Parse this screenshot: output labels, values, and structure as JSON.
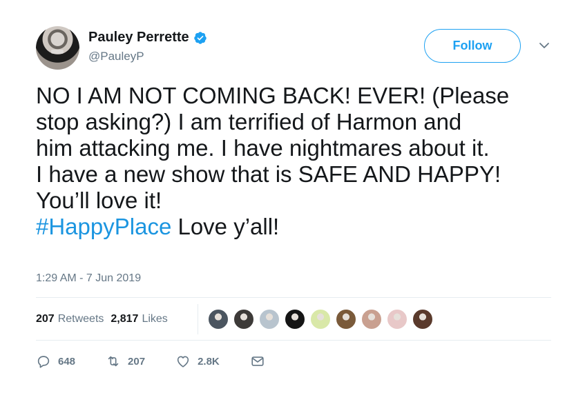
{
  "author": {
    "display_name": "Pauley Perrette",
    "handle": "@PauleyP",
    "verified": true
  },
  "follow_label": "Follow",
  "tweet": {
    "lines": [
      "NO I AM NOT COMING BACK! EVER!  (Please",
      "stop asking?) I am terrified of Harmon and",
      "him attacking me. I have nightmares about it.",
      "I have a new show that is SAFE AND HAPPY!",
      "You’ll love it!"
    ],
    "hashtag": "#HappyPlace",
    "hashtag_suffix": " Love y’all!"
  },
  "timestamp": "1:29 AM - 7 Jun 2019",
  "stats": {
    "retweets_count": "207",
    "retweets_label": "Retweets",
    "likes_count": "2,817",
    "likes_label": "Likes"
  },
  "likers": [
    {
      "color": "#4b5560"
    },
    {
      "color": "#3d3a38"
    },
    {
      "color": "#b8c4ce"
    },
    {
      "color": "#151515"
    },
    {
      "color": "#d9e8a8"
    },
    {
      "color": "#7a5a3a"
    },
    {
      "color": "#c9a090"
    },
    {
      "color": "#e8c8c8"
    },
    {
      "color": "#5a3a2c"
    }
  ],
  "actions": {
    "reply_count": "648",
    "retweet_count": "207",
    "like_count": "2.8K"
  },
  "colors": {
    "accent": "#1da1f2",
    "hashtag": "#1b95e0",
    "muted": "#657786"
  }
}
